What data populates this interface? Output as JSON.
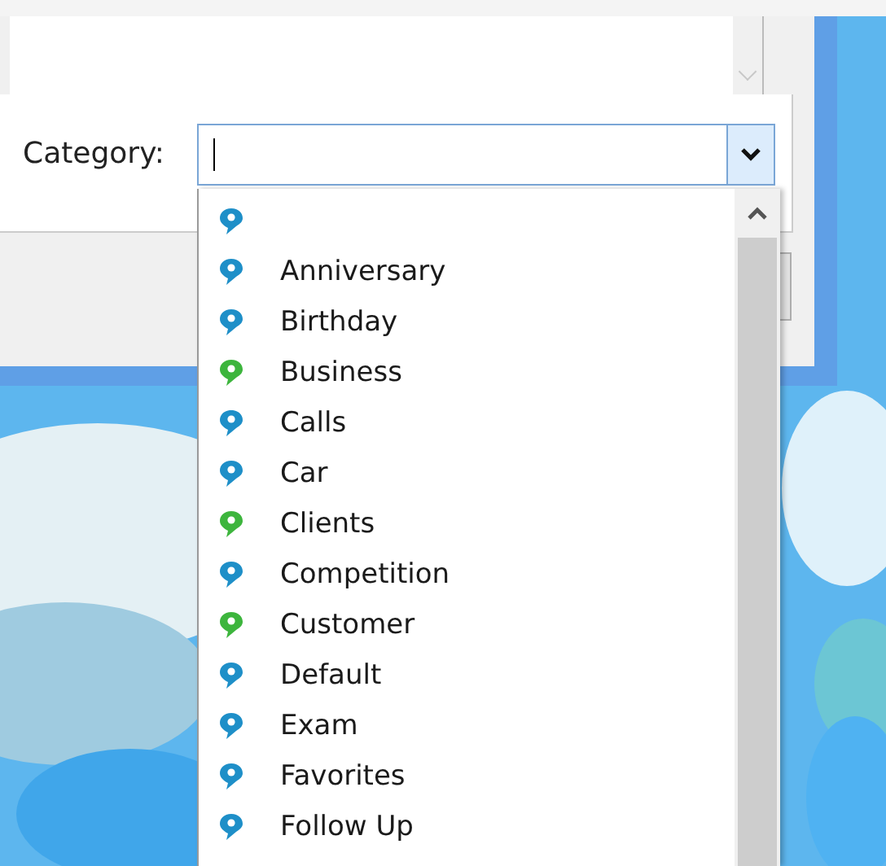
{
  "form": {
    "category_label": "Category:"
  },
  "dropdown": {
    "items": [
      {
        "color": "#1e8fc8"
      },
      {
        "label": "Anniversary",
        "color": "#1e8fc8"
      },
      {
        "label": "Birthday",
        "color": "#1e8fc8"
      },
      {
        "label": "Business",
        "color": "#3db53d"
      },
      {
        "label": "Calls",
        "color": "#1e8fc8"
      },
      {
        "label": "Car",
        "color": "#1e8fc8"
      },
      {
        "label": "Clients",
        "color": "#3db53d"
      },
      {
        "label": "Competition",
        "color": "#1e8fc8"
      },
      {
        "label": "Customer",
        "color": "#3db53d"
      },
      {
        "label": "Default",
        "color": "#1e8fc8"
      },
      {
        "label": "Exam",
        "color": "#1e8fc8"
      },
      {
        "label": "Favorites",
        "color": "#1e8fc8"
      },
      {
        "label": "Follow Up",
        "color": "#1e8fc8"
      }
    ]
  }
}
